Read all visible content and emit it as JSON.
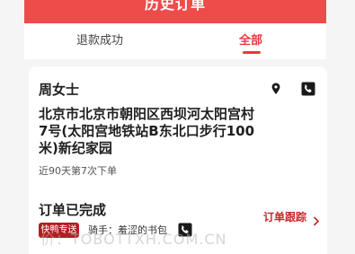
{
  "header": {
    "title": "历史订单"
  },
  "tabs": [
    {
      "label": "退款成功",
      "active": false
    },
    {
      "label": "全部",
      "active": true
    }
  ],
  "order": {
    "customer_name": "周女士",
    "address": "北京市北京市朝阳区西坝河太阳宫村7号(太阳宫地铁站B东北口步行100米)新纪家园",
    "order_history": "近90天第7次下单",
    "status": "订单已完成",
    "track_label": "订单跟踪",
    "delivery_badge": "快鸭专送",
    "rider_label": "骑手：",
    "rider_name": "羞涩的书包"
  },
  "watermark": "价：TOBOTTXH.COM.CN",
  "colors": {
    "accent": "#ee4b4b",
    "tab_active": "#e8383d",
    "badge_bg": "#b21f23",
    "track_text": "#c8252a"
  },
  "icons": {
    "location": "map-pin-icon",
    "phone": "phone-icon",
    "chevron": "chevron-right-icon"
  }
}
